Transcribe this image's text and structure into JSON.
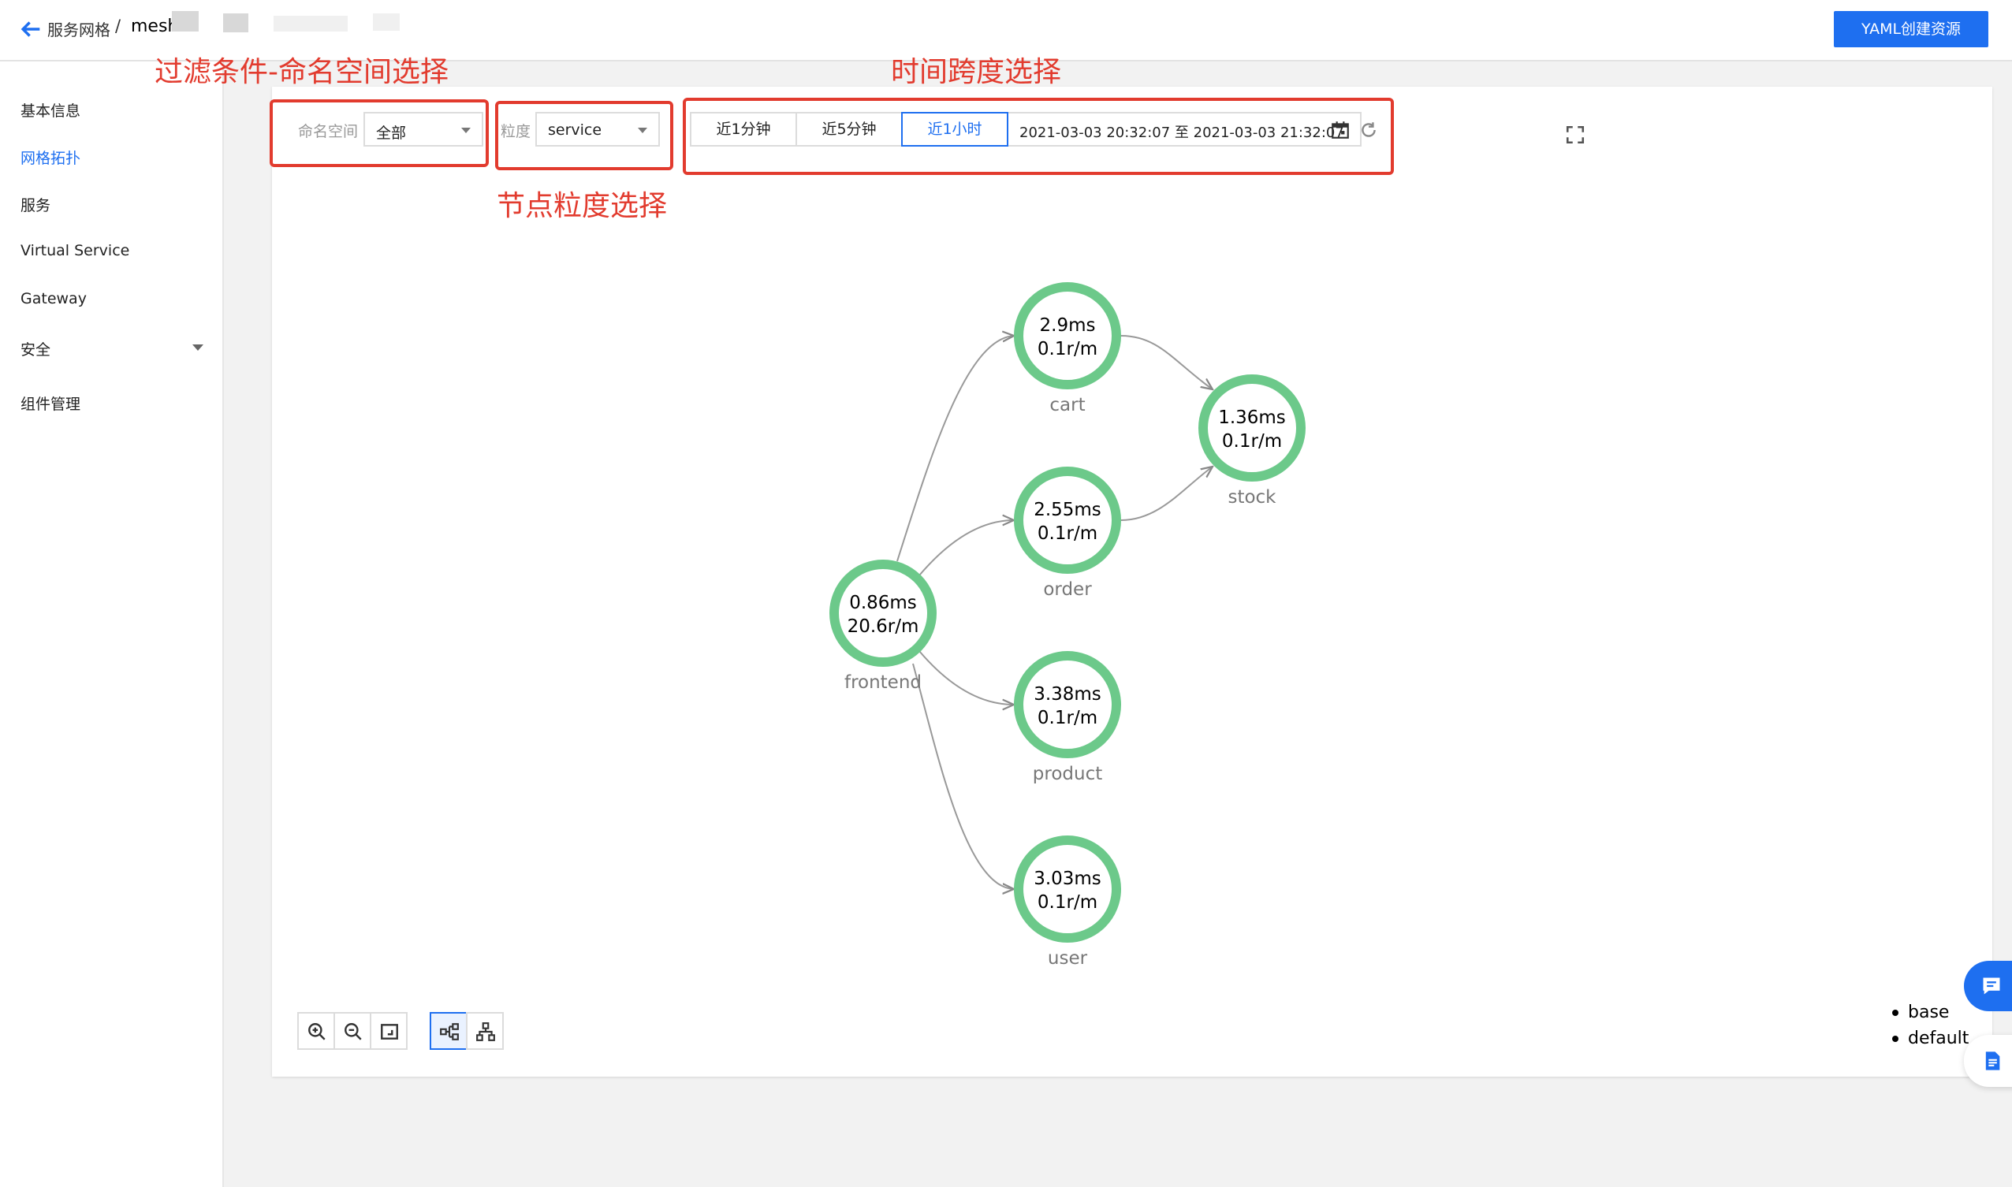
{
  "header": {
    "breadcrumb_parent": "服务网格",
    "breadcrumb_sep": "/",
    "breadcrumb_current": "mesh",
    "yaml_button": "YAML创建资源"
  },
  "sidebar": {
    "items": [
      {
        "label": "基本信息",
        "active": false
      },
      {
        "label": "网格拓扑",
        "active": true
      },
      {
        "label": "服务",
        "active": false
      },
      {
        "label": "Virtual Service",
        "active": false
      },
      {
        "label": "Gateway",
        "active": false
      },
      {
        "label": "安全",
        "active": false
      },
      {
        "label": "组件管理",
        "active": false
      }
    ]
  },
  "filters": {
    "namespace_label": "命名空间",
    "namespace_value": "全部",
    "granularity_label": "粒度",
    "granularity_value": "service",
    "time_buttons": [
      "近1分钟",
      "近5分钟",
      "近1小时"
    ],
    "active_time_button": "近1小时",
    "time_range": "2021-03-03 20:32:07 至 2021-03-03 21:32:07"
  },
  "annotations": {
    "namespace": "过滤条件-命名空间选择",
    "granularity": "节点粒度选择",
    "time": "时间跨度选择"
  },
  "topology": {
    "nodes": [
      {
        "id": "frontend",
        "latency": "0.86ms",
        "rate": "20.6r/m"
      },
      {
        "id": "cart",
        "latency": "2.9ms",
        "rate": "0.1r/m"
      },
      {
        "id": "order",
        "latency": "2.55ms",
        "rate": "0.1r/m"
      },
      {
        "id": "product",
        "latency": "3.38ms",
        "rate": "0.1r/m"
      },
      {
        "id": "user",
        "latency": "3.03ms",
        "rate": "0.1r/m"
      },
      {
        "id": "stock",
        "latency": "1.36ms",
        "rate": "0.1r/m"
      }
    ],
    "edges": [
      [
        "frontend",
        "cart"
      ],
      [
        "frontend",
        "order"
      ],
      [
        "frontend",
        "product"
      ],
      [
        "frontend",
        "user"
      ],
      [
        "cart",
        "stock"
      ],
      [
        "order",
        "stock"
      ]
    ],
    "node_color": "#6cc98a"
  },
  "legend": [
    "base",
    "default"
  ],
  "colors": {
    "accent": "#1e6ff0",
    "annotation": "#e23b2e"
  }
}
